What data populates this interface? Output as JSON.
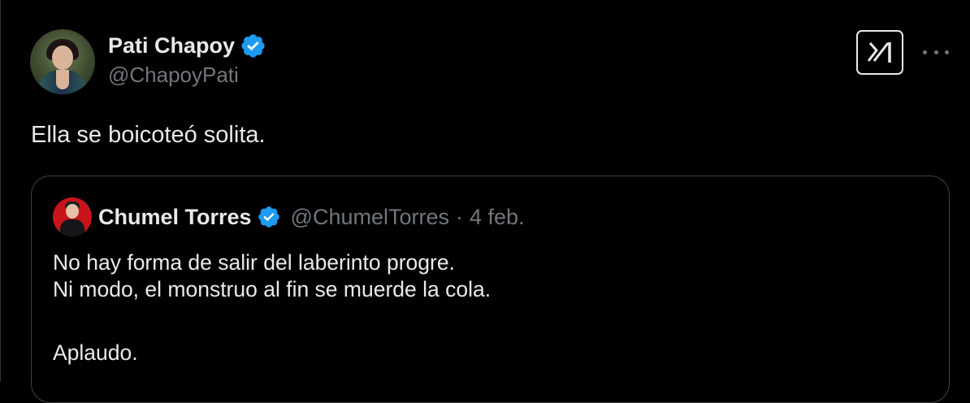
{
  "author": {
    "display_name": "Pati Chapoy",
    "handle": "@ChapoyPati",
    "verified": true
  },
  "icons": {
    "verified": "verified-badge-icon",
    "grok": "grok-icon",
    "more": "more-options-icon"
  },
  "colors": {
    "background": "#000000",
    "text": "#e7e9ea",
    "muted": "#71767b",
    "verified_blue": "#1d9bf0",
    "border": "#3e4144"
  },
  "tweet": {
    "text": "Ella se boicoteó solita."
  },
  "quoted_tweet": {
    "display_name": "Chumel Torres",
    "handle": "@ChumelTorres",
    "separator": "·",
    "date": "4 feb.",
    "verified": true,
    "lines": [
      "No hay forma de salir del laberinto progre.",
      "Ni modo, el monstruo al fin se muerde la cola.",
      "Aplaudo."
    ]
  }
}
